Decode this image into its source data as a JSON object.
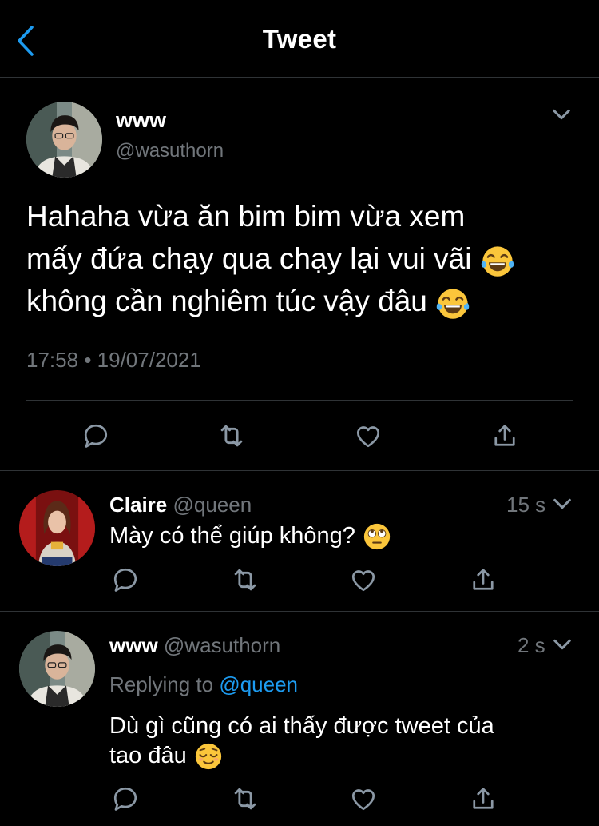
{
  "header": {
    "title": "Tweet"
  },
  "main_tweet": {
    "author_name": "www",
    "handle": "@wasuthorn",
    "text_line1": "Hahaha vừa ăn bim bim vừa xem",
    "text_line2": "mấy đứa chạy qua chạy lại vui vãi",
    "text_line3": "không cần nghiêm túc vậy đâu",
    "emoji": "face-with-tears-of-joy",
    "time": "17:58",
    "separator": "•",
    "date": "19/07/2021"
  },
  "replies": [
    {
      "author_name": "Claire",
      "handle": "@queen",
      "time_ago": "15 s",
      "text": "Mày có thể giúp không?",
      "emoji": "face-with-rolling-eyes"
    },
    {
      "author_name": "www",
      "handle": "@wasuthorn",
      "time_ago": "2 s",
      "replying_label": "Replying to",
      "replying_to": "@queen",
      "text_line1": "Dù gì cũng có ai thấy được tweet của",
      "text_line2": "tao đâu",
      "emoji": "relieved-face"
    }
  ],
  "icons": {
    "back": "back-arrow-icon",
    "more": "chevron-down-icon",
    "reply": "reply-icon",
    "retweet": "retweet-icon",
    "like": "heart-icon",
    "share": "share-icon"
  },
  "colors": {
    "background": "#000000",
    "text": "#ffffff",
    "secondary": "#71767b",
    "accent": "#1d9bf0",
    "divider": "#2f3336"
  }
}
